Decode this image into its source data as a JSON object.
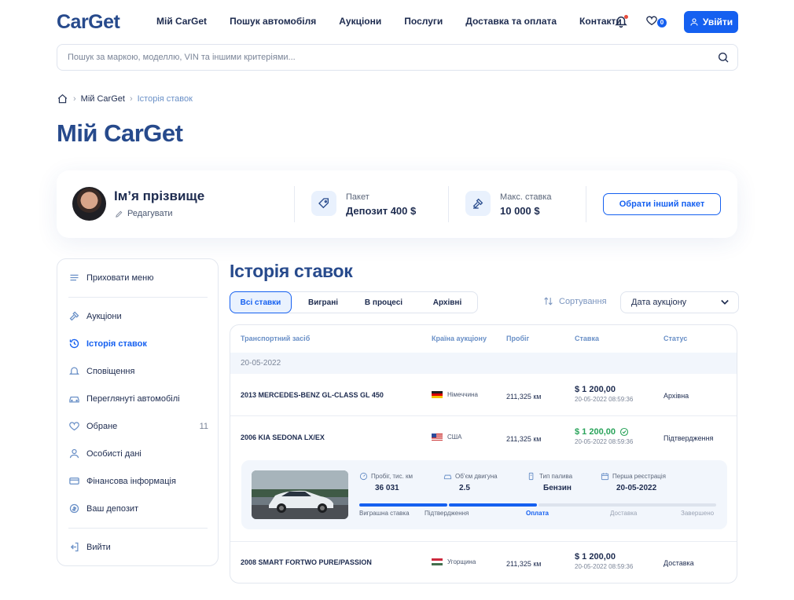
{
  "header": {
    "logo": "CarGet",
    "nav": [
      "Мій CarGet",
      "Пошук автомобіля",
      "Аукціони",
      "Послуги",
      "Доставка та оплата",
      "Контакти"
    ],
    "favorites_count": "0",
    "login_label": "Увійти"
  },
  "search": {
    "placeholder": "Пошук за маркою, моделлю, VIN та іншими критеріями..."
  },
  "breadcrumb": {
    "items": [
      "Мій CarGet",
      "Історія ставок"
    ]
  },
  "page_title": "Мій CarGet",
  "profile": {
    "name": "Ім’я прізвище",
    "edit_label": "Редагувати",
    "package_label": "Пакет",
    "package_value": "Депозит 400 $",
    "max_bid_label": "Макс. ставка",
    "max_bid_value": "10 000 $",
    "change_package_label": "Обрати інший пакет"
  },
  "sidebar": {
    "hide_menu": "Приховати меню",
    "items": [
      {
        "label": "Аукціони",
        "icon": "gavel-icon"
      },
      {
        "label": "Історія ставок",
        "icon": "history-icon",
        "active": true
      },
      {
        "label": "Сповіщення",
        "icon": "bell-icon"
      },
      {
        "label": "Переглянуті автомобілі",
        "icon": "car-icon"
      },
      {
        "label": "Обране",
        "icon": "heart-icon",
        "count": "11"
      },
      {
        "label": "Особисті дані",
        "icon": "user-icon"
      },
      {
        "label": "Фінансова інформація",
        "icon": "card-icon"
      },
      {
        "label": "Ваш депозит",
        "icon": "coins-icon"
      }
    ],
    "logout": "Вийти"
  },
  "section_title": "Історія ставок",
  "tabs": [
    "Всі ставки",
    "Виграні",
    "В процесі",
    "Архівні"
  ],
  "sort": {
    "label": "Сортування",
    "selected": "Дата аукціону"
  },
  "table": {
    "headers": [
      "Транспортний засіб",
      "Країна аукціону",
      "Пробіг",
      "Ставка",
      "Статус"
    ],
    "date_group": "20-05-2022",
    "rows": [
      {
        "vehicle": "2013 MERCEDES-BENZ GL-CLASS GL 450",
        "country": "Німеччина",
        "mileage": "211,325 км",
        "bid": "$ 1 200,00",
        "bid_date": "20-05-2022 08:59:36",
        "status": "Архівна"
      },
      {
        "vehicle": "2006 KIA SEDONA LX/EX",
        "country": "США",
        "mileage": "211,325 км",
        "bid": "$ 1 200,00",
        "bid_date": "20-05-2022 08:59:36",
        "status": "Підтвердження"
      },
      {
        "vehicle": "2008 SMART FORTWO PURE/PASSION",
        "country": "Угорщина",
        "mileage": "211,325 км",
        "bid": "$ 1 200,00",
        "bid_date": "20-05-2022 08:59:36",
        "status": "Доставка"
      }
    ],
    "detail": {
      "specs": [
        {
          "label": "Пробіг, тис. км",
          "value": "36 031"
        },
        {
          "label": "Об’єм двигуна",
          "value": "2.5"
        },
        {
          "label": "Тип палива",
          "value": "Бензин"
        },
        {
          "label": "Перша реєстрація",
          "value": "20-05-2022"
        }
      ],
      "stages": [
        "Виграшна ставка",
        "Підтвердження",
        "Оплата",
        "Доставка",
        "Завершено"
      ],
      "current_stage": "Оплата"
    }
  },
  "colors": {
    "accent": "#1560f0",
    "title": "#274a8c",
    "success": "#29a35a"
  }
}
